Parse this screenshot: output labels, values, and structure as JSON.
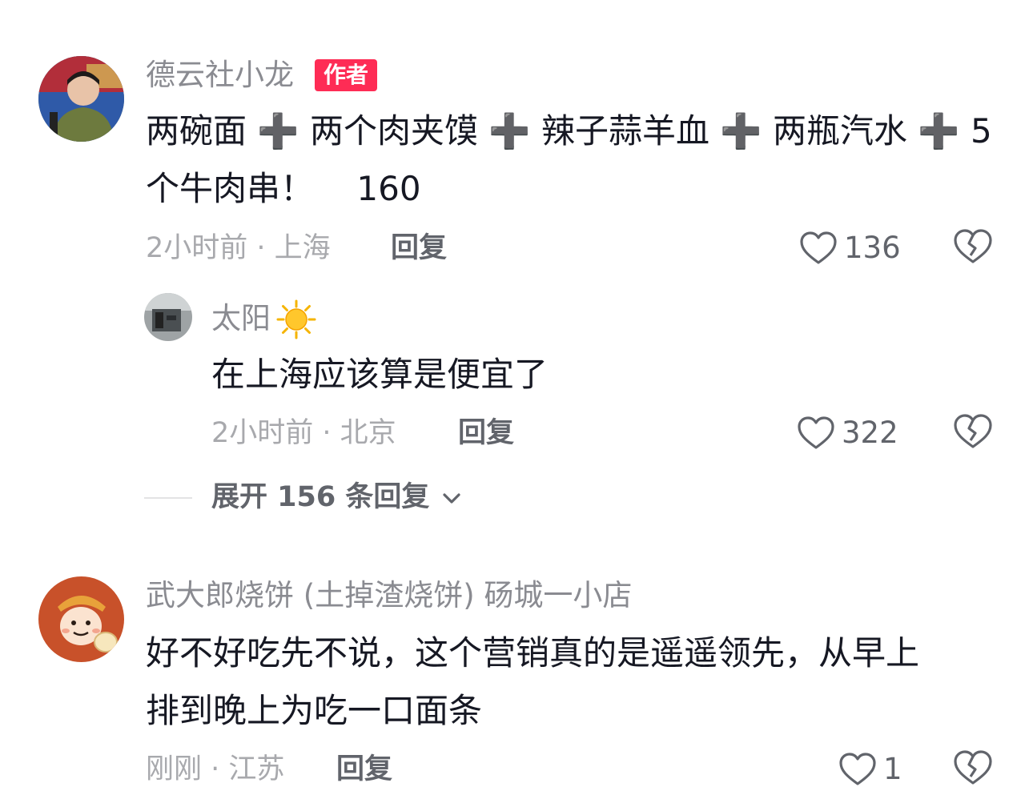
{
  "comments": [
    {
      "username": "德云社小龙",
      "badge": "作者",
      "content": "两碗面 ➕ 两个肉夹馍 ➕ 辣子蒜羊血 ➕ 两瓶汽水 ➕ 5\n个牛肉串！    160",
      "time_location": "2小时前 · 上海",
      "reply_label": "回复",
      "likes": "136"
    },
    {
      "username": "武大郎烧饼 (土掉渣烧饼) 砀城一小店",
      "content": "好不好吃先不说，这个营销真的是遥遥领先，从早上\n排到晚上为吃一口面条",
      "time_location": "刚刚 · 江苏",
      "reply_label": "回复",
      "likes": "1"
    }
  ],
  "reply": {
    "username": "太阳",
    "content": "在上海应该算是便宜了",
    "time_location": "2小时前 · 北京",
    "reply_label": "回复",
    "likes": "322"
  },
  "expand_replies_label": "展开 156 条回复",
  "colors": {
    "badge": "#fe2c55",
    "muted": "#a8a9ad",
    "text": "#161823",
    "action": "#61646b"
  }
}
